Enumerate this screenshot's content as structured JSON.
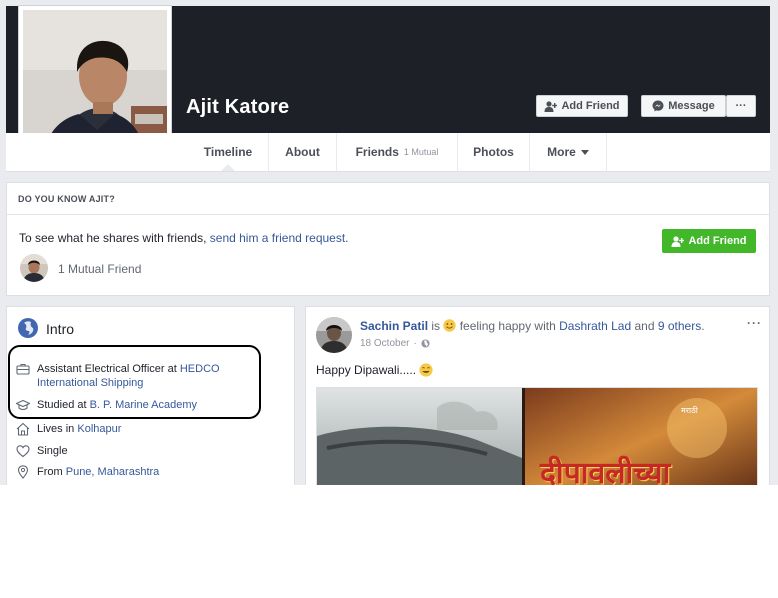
{
  "profile": {
    "name": "Ajit Katore",
    "add_friend_label": "Add Friend",
    "message_label": "Message",
    "more_label": "···"
  },
  "tabs": {
    "timeline": "Timeline",
    "about": "About",
    "friends": "Friends",
    "friends_sub": "1 Mutual",
    "photos": "Photos",
    "more": "More"
  },
  "know": {
    "heading": "DO YOU KNOW AJIT?",
    "text": "To see what he shares with friends, ",
    "link": "send him a friend request.",
    "button": "Add Friend",
    "mutual": "1 Mutual Friend"
  },
  "intro": {
    "title": "Intro",
    "work_prefix": "Assistant Electrical Officer at ",
    "work_link": "HEDCO International Shipping",
    "study_prefix": "Studied at ",
    "study_link": "B. P. Marine Academy",
    "lives_prefix": "Lives in ",
    "lives_link": "Kolhapur",
    "relationship": "Single",
    "from_prefix": "From ",
    "from_link": "Pune, Maharashtra"
  },
  "post": {
    "author": "Sachin Patil",
    "is": " is ",
    "feeling": " feeling happy with ",
    "with_name": "Dashrath Lad",
    "and": " and ",
    "others": "9 others",
    "period": ".",
    "time": "18 October",
    "dot": "·",
    "text": "Happy Dipawali.....",
    "more": "···",
    "image_text": "दीपावलीच्या",
    "image_tag": "मराठी"
  }
}
